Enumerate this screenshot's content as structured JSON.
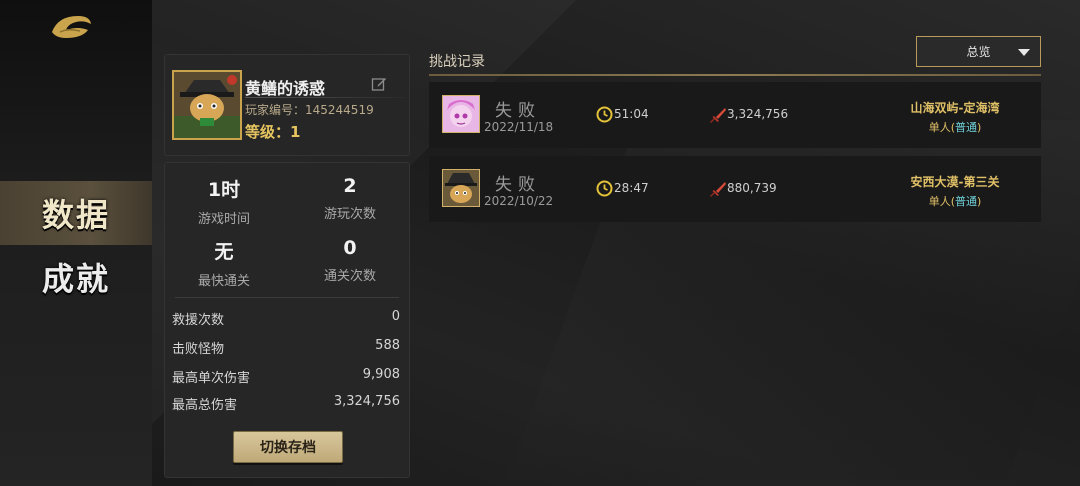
{
  "sidebar": {
    "items": [
      {
        "label": "数据",
        "active": true
      },
      {
        "label": "成就",
        "active": false
      }
    ]
  },
  "profile": {
    "name": "黄鳝的诱惑",
    "player_id": "玩家编号：145244519",
    "level": "等级：1"
  },
  "summary": [
    {
      "value": "1时",
      "label": "游戏时间"
    },
    {
      "value": "2",
      "label": "游玩次数"
    },
    {
      "value": "无",
      "label": "最快通关"
    },
    {
      "value": "0",
      "label": "通关次数"
    }
  ],
  "details": [
    {
      "label": "救援次数",
      "value": "0"
    },
    {
      "label": "击败怪物",
      "value": "588"
    },
    {
      "label": "最高单次伤害",
      "value": "9,908"
    },
    {
      "label": "最高总伤害",
      "value": "3,324,756"
    }
  ],
  "switch_button": "切换存档",
  "records_section": {
    "title": "挑战记录",
    "filter": "总览"
  },
  "records": [
    {
      "result": "失败",
      "date": "2022/11/18",
      "time": "51:04",
      "damage": "3,324,756",
      "stage": "山海双屿-定海湾",
      "mode_prefix": "单人(",
      "difficulty": "普通",
      "mode_suffix": ")",
      "avatar": "pink-hero-avatar"
    },
    {
      "result": "失败",
      "date": "2022/10/22",
      "time": "28:47",
      "damage": "880,739",
      "stage": "安西大漠-第三关",
      "mode_prefix": "单人(",
      "difficulty": "普通",
      "mode_suffix": ")",
      "avatar": "cat-hero-avatar"
    }
  ],
  "colors": {
    "accent_gold": "#e0c067",
    "difficulty_cyan": "#6fd1d8"
  }
}
